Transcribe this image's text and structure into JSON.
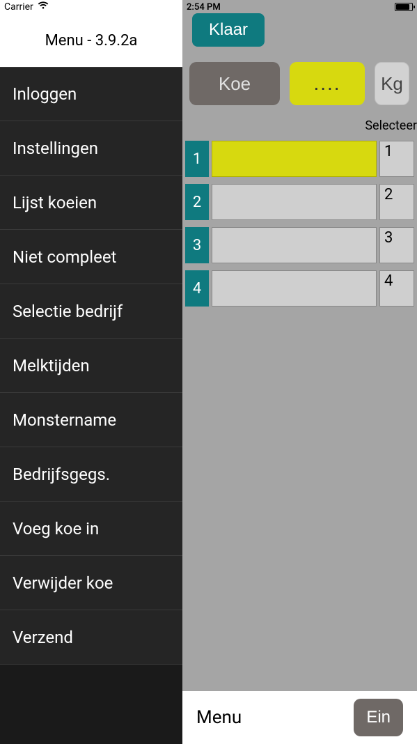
{
  "status": {
    "carrier": "Carrier",
    "time": "2:54 PM"
  },
  "sidebar": {
    "title": "Menu - 3.9.2a",
    "items": [
      {
        "label": "Inloggen"
      },
      {
        "label": "Instellingen"
      },
      {
        "label": "Lijst koeien"
      },
      {
        "label": "Niet compleet"
      },
      {
        "label": "Selectie bedrijf"
      },
      {
        "label": "Melktijden"
      },
      {
        "label": "Monstername"
      },
      {
        "label": "Bedrijfsgegs."
      },
      {
        "label": "Voeg koe in"
      },
      {
        "label": "Verwijder koe"
      },
      {
        "label": "Verzend"
      }
    ]
  },
  "topbar": {
    "klaar": "Klaar"
  },
  "headers": {
    "koe": "Koe",
    "dots": "....",
    "kg": "Kg"
  },
  "selecteer": "Selecteer",
  "rows": [
    {
      "n": "1",
      "right": "1",
      "highlight": true
    },
    {
      "n": "2",
      "right": "2",
      "highlight": false
    },
    {
      "n": "3",
      "right": "3",
      "highlight": false
    },
    {
      "n": "4",
      "right": "4",
      "highlight": false
    }
  ],
  "bottom": {
    "menu": "Menu",
    "ein": "Ein"
  }
}
